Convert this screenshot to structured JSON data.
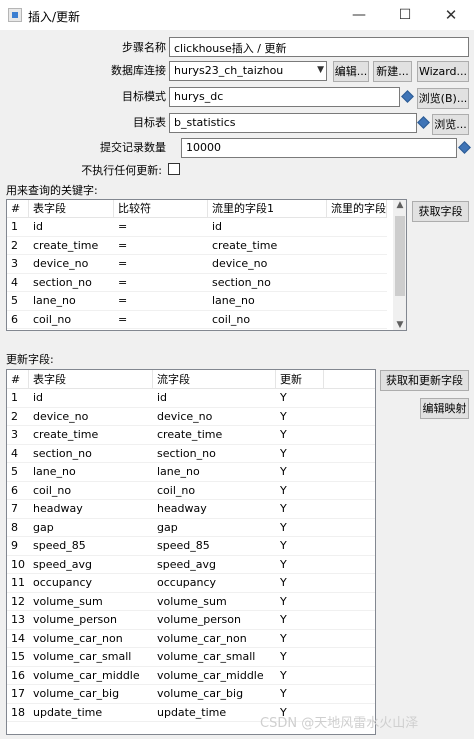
{
  "window": {
    "title": "插入/更新",
    "minimize": "—",
    "maximize": "☐",
    "close": "✕"
  },
  "form": {
    "step_name_label": "步骤名称",
    "step_name_value": "clickhouse插入 / 更新",
    "db_conn_label": "数据库连接",
    "db_conn_value": "hurys23_ch_taizhou",
    "edit_button": "编辑...",
    "new_button": "新建...",
    "wizard_button": "Wizard...",
    "target_schema_label": "目标模式",
    "target_schema_value": "hurys_dc",
    "browse_schema_button": "浏览(B)...",
    "target_table_label": "目标表",
    "target_table_value": "b_statistics",
    "browse_table_button": "浏览...",
    "commit_size_label": "提交记录数量",
    "commit_size_value": "10000",
    "no_update_label": "不执行任何更新:"
  },
  "keys": {
    "section_label": "用来查询的关键字:",
    "get_fields_button": "获取字段",
    "columns": [
      "#",
      "表字段",
      "比较符",
      "流里的字段1",
      "流里的字段..."
    ],
    "rows": [
      [
        "1",
        "id",
        "=",
        "id",
        ""
      ],
      [
        "2",
        "create_time",
        "=",
        "create_time",
        ""
      ],
      [
        "3",
        "device_no",
        "=",
        "device_no",
        ""
      ],
      [
        "4",
        "section_no",
        "=",
        "section_no",
        ""
      ],
      [
        "5",
        "lane_no",
        "=",
        "lane_no",
        ""
      ],
      [
        "6",
        "coil_no",
        "=",
        "coil_no",
        ""
      ]
    ]
  },
  "update": {
    "section_label": "更新字段:",
    "get_update_fields_button": "获取和更新字段",
    "edit_mapping_button": "编辑映射",
    "columns": [
      "#",
      "表字段",
      "流字段",
      "更新"
    ],
    "rows": [
      [
        "1",
        "id",
        "id",
        "Y"
      ],
      [
        "2",
        "device_no",
        "device_no",
        "Y"
      ],
      [
        "3",
        "create_time",
        "create_time",
        "Y"
      ],
      [
        "4",
        "section_no",
        "section_no",
        "Y"
      ],
      [
        "5",
        "lane_no",
        "lane_no",
        "Y"
      ],
      [
        "6",
        "coil_no",
        "coil_no",
        "Y"
      ],
      [
        "7",
        "headway",
        "headway",
        "Y"
      ],
      [
        "8",
        "gap",
        "gap",
        "Y"
      ],
      [
        "9",
        "speed_85",
        "speed_85",
        "Y"
      ],
      [
        "10",
        "speed_avg",
        "speed_avg",
        "Y"
      ],
      [
        "11",
        "occupancy",
        "occupancy",
        "Y"
      ],
      [
        "12",
        "volume_sum",
        "volume_sum",
        "Y"
      ],
      [
        "13",
        "volume_person",
        "volume_person",
        "Y"
      ],
      [
        "14",
        "volume_car_non",
        "volume_car_non",
        "Y"
      ],
      [
        "15",
        "volume_car_small",
        "volume_car_small",
        "Y"
      ],
      [
        "16",
        "volume_car_middle",
        "volume_car_middle",
        "Y"
      ],
      [
        "17",
        "volume_car_big",
        "volume_car_big",
        "Y"
      ],
      [
        "18",
        "update_time",
        "update_time",
        "Y"
      ]
    ]
  },
  "watermark": "CSDN @天地风雷水火山泽"
}
